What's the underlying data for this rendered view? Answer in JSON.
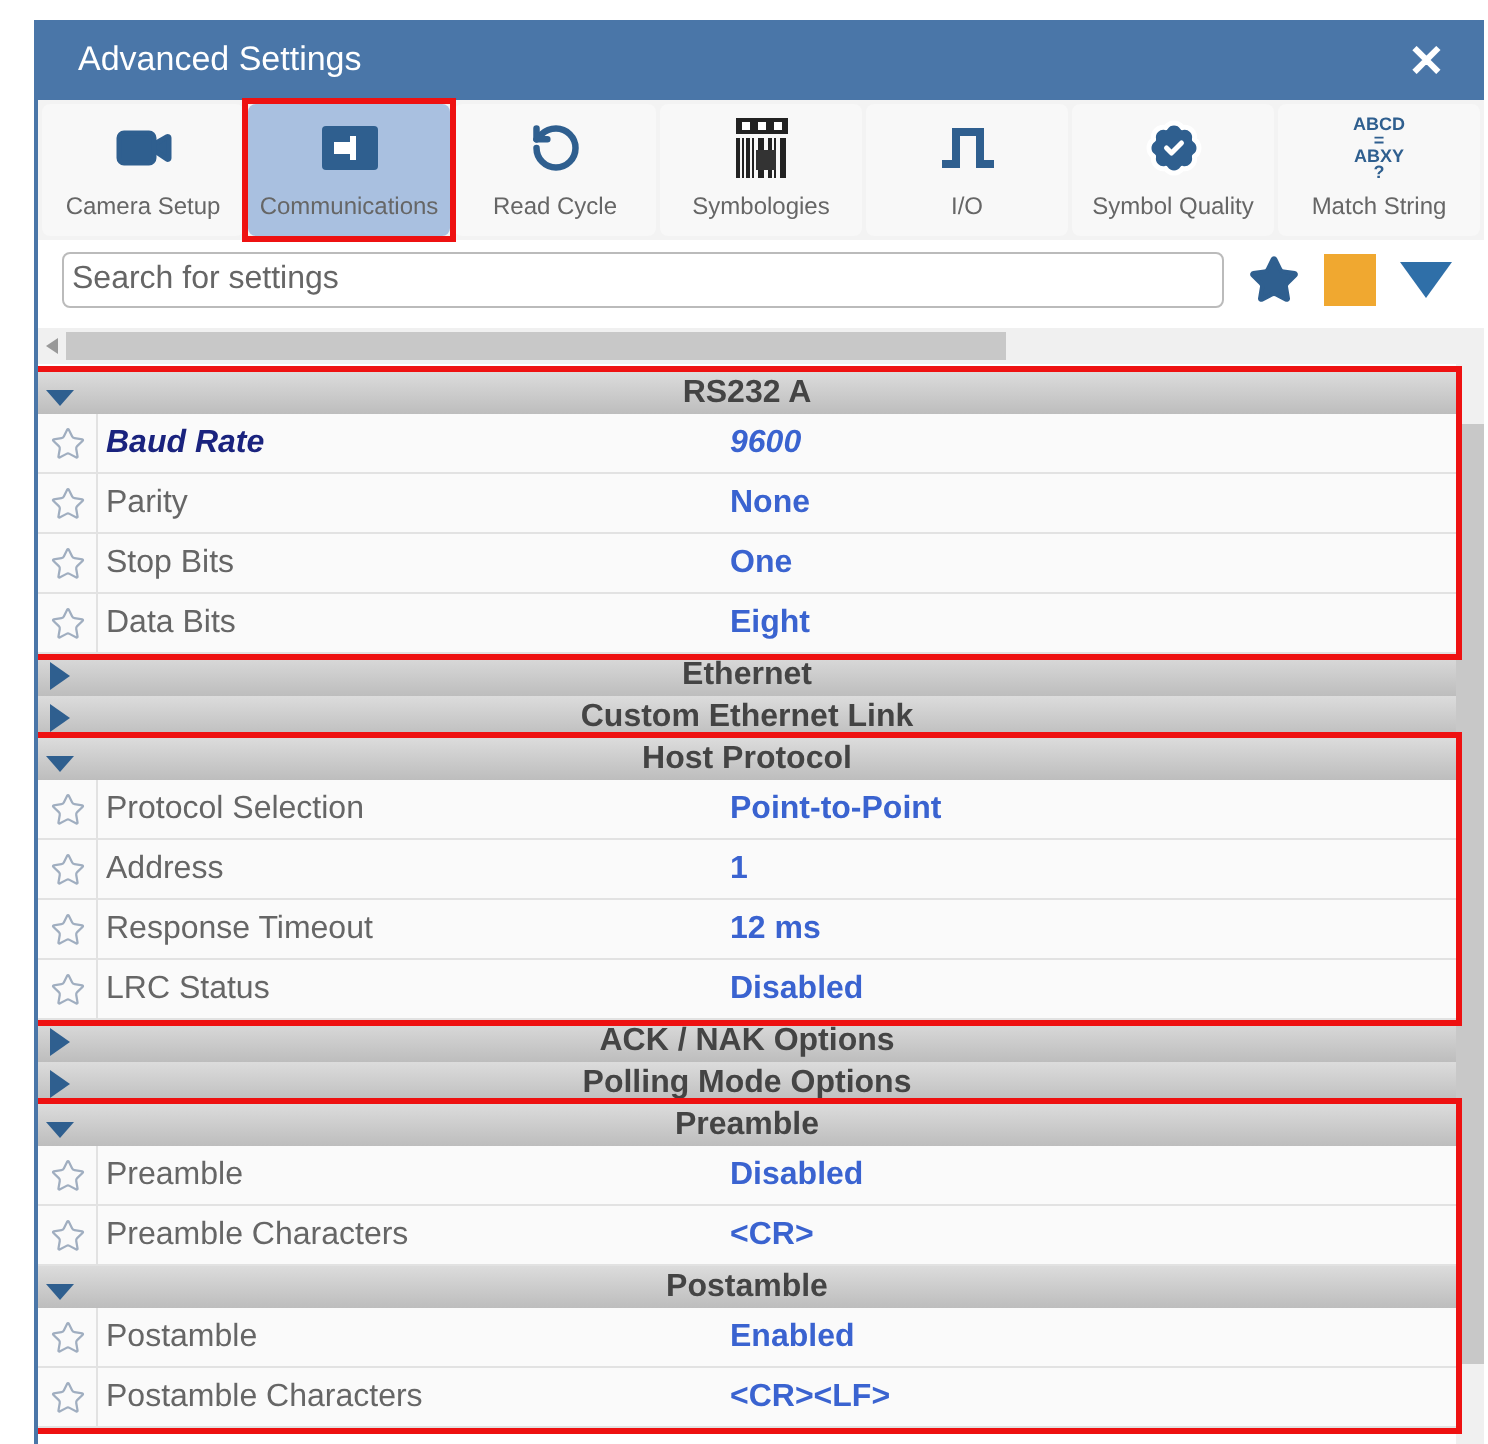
{
  "window": {
    "title": "Advanced Settings",
    "close": "✕"
  },
  "tabs": [
    {
      "label": "Camera Setup",
      "kind": "camera",
      "selected": false,
      "highlighted": false
    },
    {
      "label": "Communications",
      "kind": "plug",
      "selected": true,
      "highlighted": true
    },
    {
      "label": "Read Cycle",
      "kind": "cycle",
      "selected": false,
      "highlighted": false
    },
    {
      "label": "Symbologies",
      "kind": "barcode",
      "selected": false,
      "highlighted": false
    },
    {
      "label": "I/O",
      "kind": "pulse",
      "selected": false,
      "highlighted": false
    },
    {
      "label": "Symbol Quality",
      "kind": "badge",
      "selected": false,
      "highlighted": false
    },
    {
      "label": "Match String",
      "kind": "text",
      "icon_lines": [
        "ABCD",
        "=",
        "ABXY",
        "?"
      ],
      "selected": false,
      "highlighted": false
    }
  ],
  "search": {
    "placeholder": "Search for settings"
  },
  "groups": [
    {
      "highlighted": true,
      "sections": [
        {
          "title": "RS232 A",
          "expanded": true,
          "settings": [
            {
              "label": "Baud Rate",
              "value": "9600",
              "modified": true
            },
            {
              "label": "Parity",
              "value": "None",
              "modified": false
            },
            {
              "label": "Stop Bits",
              "value": "One",
              "modified": false
            },
            {
              "label": "Data Bits",
              "value": "Eight",
              "modified": false
            }
          ]
        }
      ]
    },
    {
      "highlighted": false,
      "sections": [
        {
          "title": "Ethernet",
          "expanded": false
        },
        {
          "title": "Custom Ethernet Link",
          "expanded": false
        }
      ]
    },
    {
      "highlighted": true,
      "sections": [
        {
          "title": "Host Protocol",
          "expanded": true,
          "settings": [
            {
              "label": "Protocol Selection",
              "value": "Point-to-Point",
              "modified": false
            },
            {
              "label": "Address",
              "value": "1",
              "modified": false
            },
            {
              "label": "Response Timeout",
              "value": "12 ms",
              "modified": false
            },
            {
              "label": "LRC Status",
              "value": "Disabled",
              "modified": false
            }
          ]
        }
      ]
    },
    {
      "highlighted": false,
      "sections": [
        {
          "title": "ACK / NAK Options",
          "expanded": false
        },
        {
          "title": "Polling Mode Options",
          "expanded": false
        }
      ]
    },
    {
      "highlighted": true,
      "sections": [
        {
          "title": "Preamble",
          "expanded": true,
          "settings": [
            {
              "label": "Preamble",
              "value": "Disabled",
              "modified": false
            },
            {
              "label": "Preamble Characters",
              "value": "<CR>",
              "modified": false
            }
          ]
        },
        {
          "title": "Postamble",
          "expanded": true,
          "settings": [
            {
              "label": "Postamble",
              "value": "Enabled",
              "modified": false
            },
            {
              "label": "Postamble Characters",
              "value": "<CR><LF>",
              "modified": false
            }
          ]
        }
      ]
    }
  ]
}
